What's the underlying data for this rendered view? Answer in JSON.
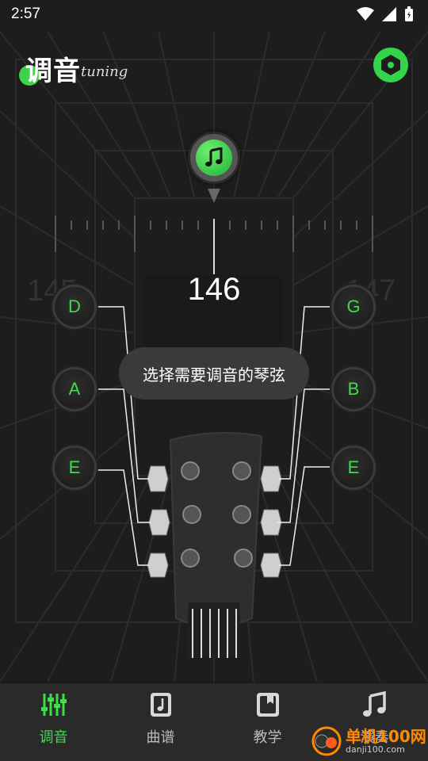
{
  "status_bar": {
    "time": "2:57"
  },
  "header": {
    "title": "调音",
    "subtitle": "tuning"
  },
  "tuner": {
    "frequency": "146",
    "frequency_prev": "145",
    "frequency_next": "147",
    "tooltip": "选择需要调音的琴弦"
  },
  "strings": {
    "left": [
      "D",
      "A",
      "E"
    ],
    "right": [
      "G",
      "B",
      "E"
    ]
  },
  "tabbar": {
    "items": [
      {
        "label": "调音",
        "icon": "sliders-icon",
        "active": true
      },
      {
        "label": "曲谱",
        "icon": "sheet-music-icon",
        "active": false
      },
      {
        "label": "教学",
        "icon": "book-icon",
        "active": false
      },
      {
        "label": "演奏",
        "icon": "music-note-icon",
        "active": false
      }
    ]
  },
  "watermark": {
    "title": "单机100网",
    "subtitle": "danji100.com"
  },
  "colors": {
    "accent": "#3fdc4c",
    "background": "#1b1b1b",
    "tabbar": "#2a2a2a"
  }
}
